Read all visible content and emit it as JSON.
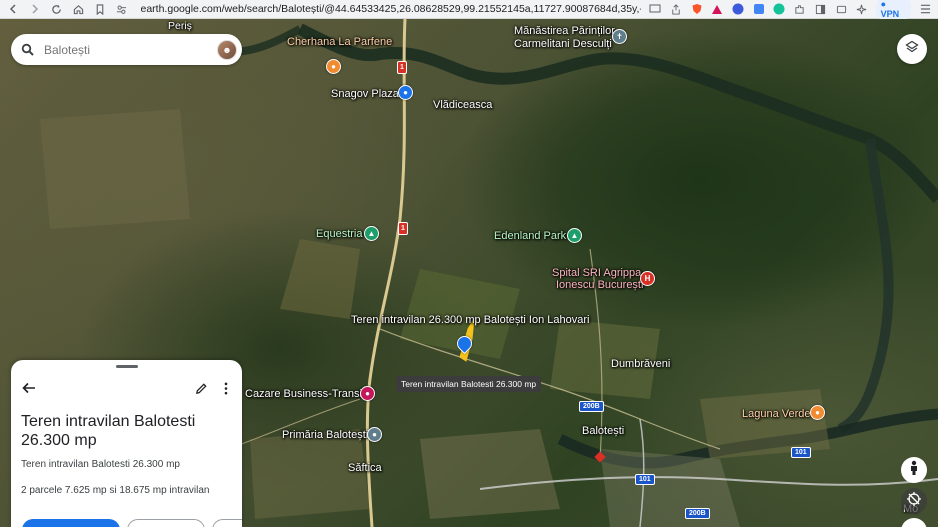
{
  "browser": {
    "url": "earth.google.com/web/search/Balotești/@44.64533425,26.08628529,99.21552145a,11727.90087684d,35y,-0h,0...",
    "vpn_label": "VPN"
  },
  "search": {
    "placeholder": "Balotești",
    "value": ""
  },
  "map": {
    "labels": {
      "peris": "Periș",
      "cherhana": "Cherhana La Parfene",
      "manastirea_line1": "Mănăstirea Părinților",
      "manastirea_line2": "Carmelitani Desculți",
      "snagov_plaza": "Snagov Plaza",
      "vladiceasca": "Vlădiceasca",
      "equestria": "Equestria",
      "edenland": "Edenland Park",
      "spital_line1": "Spital SRI Agrippa",
      "spital_line2": "Ionescu București",
      "teren": "Teren intravilan  26.300 mp Balotești Ion Lahovari",
      "dumbraveni": "Dumbrăveni",
      "cazare": "Cazare Business-Transit",
      "laguna": "Laguna Verde",
      "primaria": "Primăria Balotești",
      "balotesti": "Balotești",
      "saftica": "Săftica",
      "mo": "Mo"
    },
    "road_badges": {
      "r1": "1",
      "r200b": "200B",
      "r101": "101"
    },
    "tooltip": "Teren intravilan Balotesti 26.300 mp"
  },
  "panel": {
    "title": "Teren intravilan Balotesti 26.300 mp",
    "subtitle": "Teren intravilan Balotesti 26.300 mp",
    "description": "2 parcele 7.625 mp si 18.675 mp intravilan"
  },
  "colors": {
    "accent": "#1a73e8",
    "pin_orange": "#f28b30",
    "pin_green": "#1e9e6a",
    "pin_blue": "#1a73e8",
    "pin_pink": "#c2185b",
    "pin_red": "#d93025"
  }
}
